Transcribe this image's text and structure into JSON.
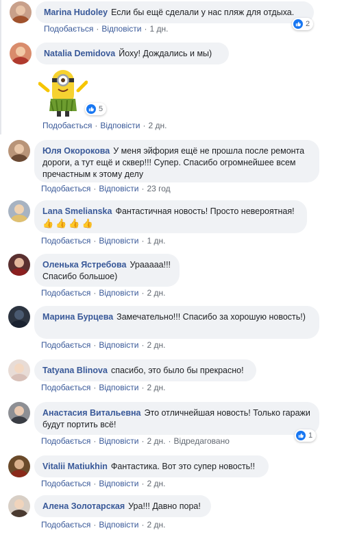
{
  "ui": {
    "like_label": "Подобається",
    "reply_label": "Відповісти",
    "edited_label": "Відредаговано",
    "sep": "·",
    "accent_color": "#385898",
    "like_blue": "#1877f2"
  },
  "comments": [
    {
      "author": "Marina Hudoley",
      "text": "Если бы ещё сделали у нас пляж для отдыха.",
      "time": "1 дн.",
      "reactions": "2"
    },
    {
      "author": "Natalia Demidova",
      "text": "Йоху! Дождались и мы)",
      "time": "2 дн.",
      "reactions": "5",
      "sticker": "minion-sticker"
    },
    {
      "author": "Юля Окорокова",
      "text": "У меня эйфория ещё не прошла после ремонта дороги, а тут ещё и сквер!!! Супер. Спасибо огромнейшее всем пречастным к этому делу",
      "time": "23 год"
    },
    {
      "author": "Lana Smelianska",
      "text": "Фантастичная новость! Просто невероятная!",
      "emoji": "👍👍👍👍",
      "time": "1 дн."
    },
    {
      "author": "Оленька Ястребова",
      "text": "Урааааа!!! Спасибо большое)",
      "time": "2 дн."
    },
    {
      "author": "Марина Бурцева",
      "text": "Замечательно!!! Спасибо за хорошую новость!)",
      "time": "2 дн."
    },
    {
      "author": "Tatyana Blinova",
      "text": "спасибо, это было бы прекрасно!",
      "time": "2 дн."
    },
    {
      "author": "Анастасия Витальевна",
      "text": "Это отличнейшая новость! Только гаражи будут портить всё!",
      "time": "2 дн.",
      "reactions": "1",
      "edited": true
    },
    {
      "author": "Vitalii Matiukhin",
      "text": "Фантастика. Вот это супер новость!!",
      "time": "2 дн."
    },
    {
      "author": "Алена Золотарская",
      "text": "Ура!!! Давно пора!",
      "time": "2 дн."
    }
  ]
}
